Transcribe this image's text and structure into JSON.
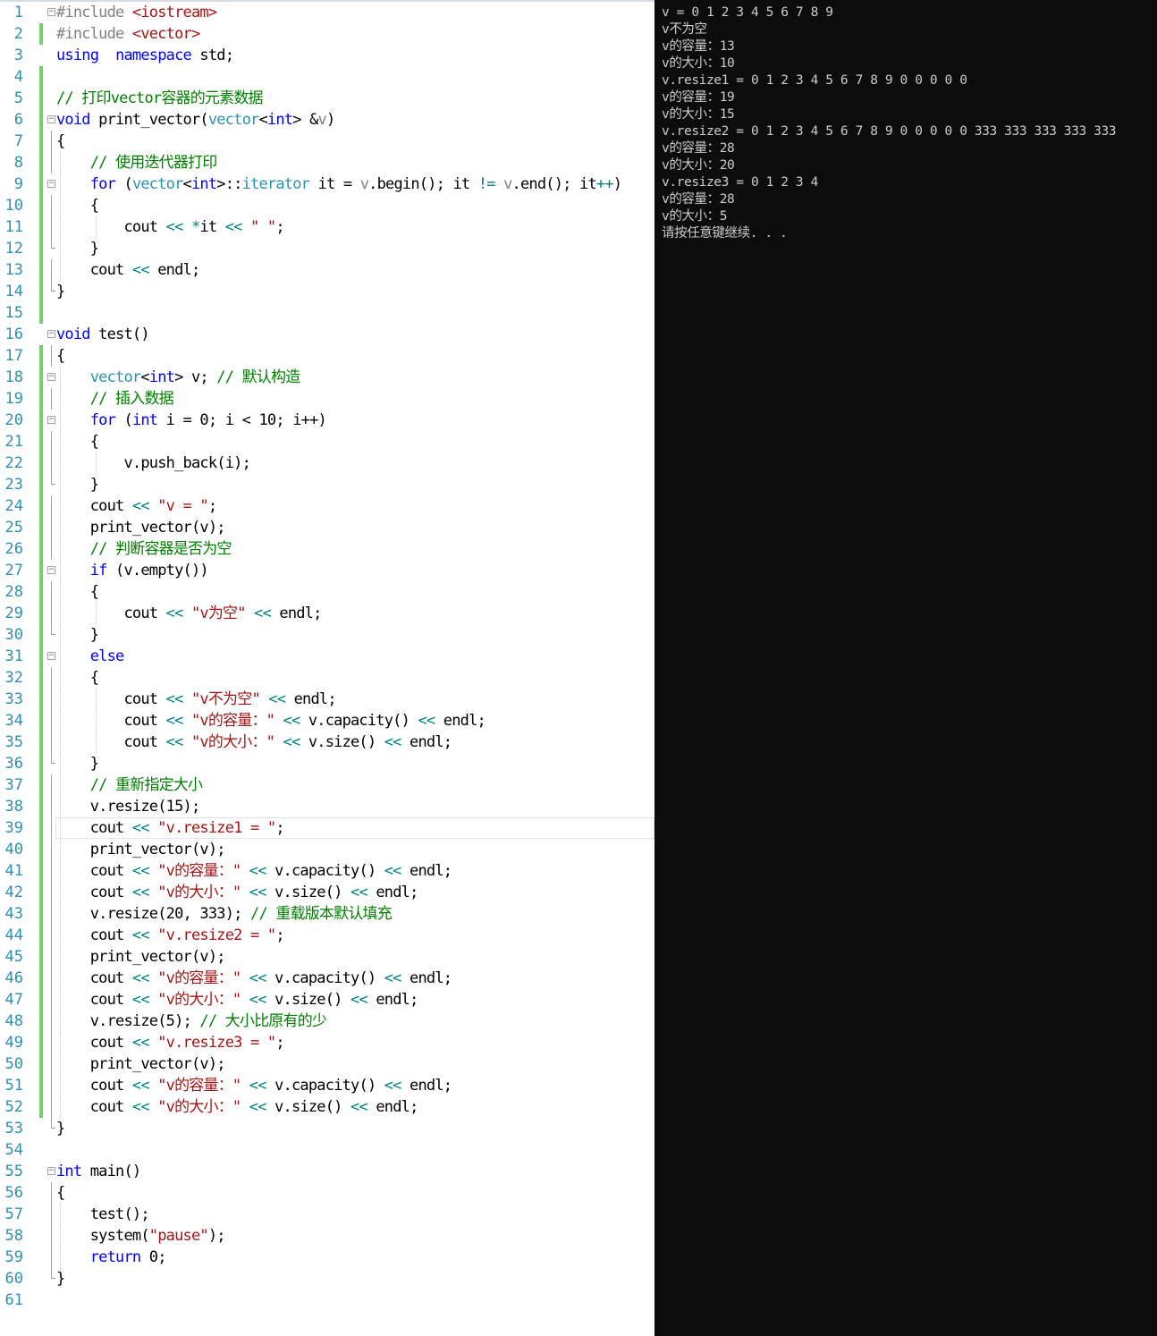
{
  "editor": {
    "lines": [
      {
        "n": "1",
        "fold": "open",
        "change": "none",
        "segs": [
          [
            "pp",
            "#include "
          ],
          [
            "str",
            "<iostream>"
          ]
        ]
      },
      {
        "n": "2",
        "change": "green",
        "segs": [
          [
            "pp",
            "#include "
          ],
          [
            "str",
            "<vector>"
          ]
        ]
      },
      {
        "n": "3",
        "change": "none",
        "segs": [
          [
            "kw",
            "using"
          ],
          [
            "",
            "  "
          ],
          [
            "kw",
            "namespace"
          ],
          [
            "",
            " std;"
          ]
        ]
      },
      {
        "n": "4",
        "change": "green",
        "segs": []
      },
      {
        "n": "5",
        "change": "green",
        "segs": [
          [
            "cm",
            "// 打印vector容器的元素数据"
          ]
        ]
      },
      {
        "n": "6",
        "fold": "open",
        "change": "green",
        "segs": [
          [
            "kw",
            "void"
          ],
          [
            "",
            " print_vector("
          ],
          [
            "ty",
            "vector"
          ],
          [
            "",
            "<"
          ],
          [
            "kw",
            "int"
          ],
          [
            "",
            "> &"
          ],
          [
            "pm",
            "v"
          ],
          [
            "",
            ")"
          ]
        ]
      },
      {
        "n": "7",
        "change": "green",
        "segs": [
          [
            "",
            "{"
          ]
        ]
      },
      {
        "n": "8",
        "change": "green",
        "segs": [
          [
            "",
            "    "
          ],
          [
            "cm",
            "// 使用迭代器打印"
          ]
        ]
      },
      {
        "n": "9",
        "fold": "open",
        "change": "green",
        "segs": [
          [
            "",
            "    "
          ],
          [
            "kw",
            "for"
          ],
          [
            "",
            " ("
          ],
          [
            "ty",
            "vector"
          ],
          [
            "",
            "<"
          ],
          [
            "kw",
            "int"
          ],
          [
            "",
            ">::"
          ],
          [
            "ty",
            "iterator"
          ],
          [
            "",
            " it = "
          ],
          [
            "pm",
            "v"
          ],
          [
            "",
            ".begin(); it "
          ],
          [
            "op",
            "!="
          ],
          [
            " ",
            " "
          ],
          [
            "pm",
            "v"
          ],
          [
            "",
            ".end(); it"
          ],
          [
            "op",
            "++"
          ],
          [
            "",
            ")"
          ]
        ]
      },
      {
        "n": "10",
        "change": "green",
        "segs": [
          [
            "",
            "    {"
          ]
        ]
      },
      {
        "n": "11",
        "change": "green",
        "segs": [
          [
            "",
            "        cout "
          ],
          [
            "op",
            "<<"
          ],
          [
            "",
            " "
          ],
          [
            "op",
            "*"
          ],
          [
            "",
            "it "
          ],
          [
            "op",
            "<<"
          ],
          [
            "",
            " "
          ],
          [
            "str",
            "\" \""
          ],
          [
            "",
            ";"
          ]
        ]
      },
      {
        "n": "12",
        "change": "green",
        "segs": [
          [
            "",
            "    }"
          ]
        ]
      },
      {
        "n": "13",
        "change": "green",
        "segs": [
          [
            "",
            "    cout "
          ],
          [
            "op",
            "<<"
          ],
          [
            "",
            " endl;"
          ]
        ]
      },
      {
        "n": "14",
        "change": "green",
        "segs": [
          [
            "",
            "}"
          ]
        ]
      },
      {
        "n": "15",
        "change": "green",
        "segs": []
      },
      {
        "n": "16",
        "fold": "open",
        "change": "none",
        "segs": [
          [
            "kw",
            "void"
          ],
          [
            "",
            " test()"
          ]
        ]
      },
      {
        "n": "17",
        "change": "green",
        "segs": [
          [
            "",
            "{"
          ]
        ]
      },
      {
        "n": "18",
        "fold": "open",
        "change": "green",
        "segs": [
          [
            "",
            "    "
          ],
          [
            "ty",
            "vector"
          ],
          [
            "",
            "<"
          ],
          [
            "kw",
            "int"
          ],
          [
            "",
            "> v; "
          ],
          [
            "cm",
            "// 默认构造"
          ]
        ]
      },
      {
        "n": "19",
        "change": "green",
        "segs": [
          [
            "",
            "    "
          ],
          [
            "cm",
            "// 插入数据"
          ]
        ]
      },
      {
        "n": "20",
        "fold": "open",
        "change": "green",
        "segs": [
          [
            "",
            "    "
          ],
          [
            "kw",
            "for"
          ],
          [
            "",
            " ("
          ],
          [
            "kw",
            "int"
          ],
          [
            "",
            " i = 0; i < 10; i++)"
          ]
        ]
      },
      {
        "n": "21",
        "change": "green",
        "segs": [
          [
            "",
            "    {"
          ]
        ]
      },
      {
        "n": "22",
        "change": "green",
        "segs": [
          [
            "",
            "        v.push_back(i);"
          ]
        ]
      },
      {
        "n": "23",
        "change": "green",
        "segs": [
          [
            "",
            "    }"
          ]
        ]
      },
      {
        "n": "24",
        "change": "green",
        "segs": [
          [
            "",
            "    cout "
          ],
          [
            "op",
            "<<"
          ],
          [
            "",
            " "
          ],
          [
            "str",
            "\"v = \""
          ],
          [
            "",
            ";"
          ]
        ]
      },
      {
        "n": "25",
        "change": "green",
        "segs": [
          [
            "",
            "    print_vector(v);"
          ]
        ]
      },
      {
        "n": "26",
        "change": "green",
        "segs": [
          [
            "",
            "    "
          ],
          [
            "cm",
            "// 判断容器是否为空"
          ]
        ]
      },
      {
        "n": "27",
        "fold": "open",
        "change": "green",
        "segs": [
          [
            "",
            "    "
          ],
          [
            "kw",
            "if"
          ],
          [
            "",
            " (v.empty())"
          ]
        ]
      },
      {
        "n": "28",
        "change": "green",
        "segs": [
          [
            "",
            "    {"
          ]
        ]
      },
      {
        "n": "29",
        "change": "green",
        "segs": [
          [
            "",
            "        cout "
          ],
          [
            "op",
            "<<"
          ],
          [
            "",
            " "
          ],
          [
            "str",
            "\"v为空\""
          ],
          [
            "",
            " "
          ],
          [
            "op",
            "<<"
          ],
          [
            "",
            " endl;"
          ]
        ]
      },
      {
        "n": "30",
        "change": "green",
        "segs": [
          [
            "",
            "    }"
          ]
        ]
      },
      {
        "n": "31",
        "fold": "open",
        "change": "green",
        "segs": [
          [
            "",
            "    "
          ],
          [
            "kw",
            "else"
          ]
        ]
      },
      {
        "n": "32",
        "change": "green",
        "segs": [
          [
            "",
            "    {"
          ]
        ]
      },
      {
        "n": "33",
        "change": "green",
        "segs": [
          [
            "",
            "        cout "
          ],
          [
            "op",
            "<<"
          ],
          [
            "",
            " "
          ],
          [
            "str",
            "\"v不为空\""
          ],
          [
            "",
            " "
          ],
          [
            "op",
            "<<"
          ],
          [
            "",
            " endl;"
          ]
        ]
      },
      {
        "n": "34",
        "change": "green",
        "segs": [
          [
            "",
            "        cout "
          ],
          [
            "op",
            "<<"
          ],
          [
            "",
            " "
          ],
          [
            "str",
            "\"v的容量：\""
          ],
          [
            "",
            " "
          ],
          [
            "op",
            "<<"
          ],
          [
            "",
            " v.capacity() "
          ],
          [
            "op",
            "<<"
          ],
          [
            "",
            " endl;"
          ]
        ]
      },
      {
        "n": "35",
        "change": "green",
        "segs": [
          [
            "",
            "        cout "
          ],
          [
            "op",
            "<<"
          ],
          [
            "",
            " "
          ],
          [
            "str",
            "\"v的大小：\""
          ],
          [
            "",
            " "
          ],
          [
            "op",
            "<<"
          ],
          [
            "",
            " v.size() "
          ],
          [
            "op",
            "<<"
          ],
          [
            "",
            " endl;"
          ]
        ]
      },
      {
        "n": "36",
        "change": "green",
        "segs": [
          [
            "",
            "    }"
          ]
        ]
      },
      {
        "n": "37",
        "change": "green",
        "segs": [
          [
            "",
            "    "
          ],
          [
            "cm",
            "// 重新指定大小"
          ]
        ]
      },
      {
        "n": "38",
        "change": "green",
        "segs": [
          [
            "",
            "    v.resize(15);"
          ]
        ]
      },
      {
        "n": "39",
        "change": "green",
        "current": true,
        "segs": [
          [
            "",
            "    cout "
          ],
          [
            "op",
            "<<"
          ],
          [
            "",
            " "
          ],
          [
            "str",
            "\"v.resize1 = \""
          ],
          [
            "",
            ";"
          ]
        ]
      },
      {
        "n": "40",
        "change": "green",
        "segs": [
          [
            "",
            "    print_vector(v);"
          ]
        ]
      },
      {
        "n": "41",
        "change": "green",
        "segs": [
          [
            "",
            "    cout "
          ],
          [
            "op",
            "<<"
          ],
          [
            "",
            " "
          ],
          [
            "str",
            "\"v的容量：\""
          ],
          [
            "",
            " "
          ],
          [
            "op",
            "<<"
          ],
          [
            "",
            " v.capacity() "
          ],
          [
            "op",
            "<<"
          ],
          [
            "",
            " endl;"
          ]
        ]
      },
      {
        "n": "42",
        "change": "green",
        "segs": [
          [
            "",
            "    cout "
          ],
          [
            "op",
            "<<"
          ],
          [
            "",
            " "
          ],
          [
            "str",
            "\"v的大小：\""
          ],
          [
            "",
            " "
          ],
          [
            "op",
            "<<"
          ],
          [
            "",
            " v.size() "
          ],
          [
            "op",
            "<<"
          ],
          [
            "",
            " endl;"
          ]
        ]
      },
      {
        "n": "43",
        "change": "green",
        "segs": [
          [
            "",
            "    v.resize(20, 333); "
          ],
          [
            "cm",
            "// 重载版本默认填充"
          ]
        ]
      },
      {
        "n": "44",
        "change": "green",
        "segs": [
          [
            "",
            "    cout "
          ],
          [
            "op",
            "<<"
          ],
          [
            "",
            " "
          ],
          [
            "str",
            "\"v.resize2 = \""
          ],
          [
            "",
            ";"
          ]
        ]
      },
      {
        "n": "45",
        "change": "green",
        "segs": [
          [
            "",
            "    print_vector(v);"
          ]
        ]
      },
      {
        "n": "46",
        "change": "green",
        "segs": [
          [
            "",
            "    cout "
          ],
          [
            "op",
            "<<"
          ],
          [
            "",
            " "
          ],
          [
            "str",
            "\"v的容量：\""
          ],
          [
            "",
            " "
          ],
          [
            "op",
            "<<"
          ],
          [
            "",
            " v.capacity() "
          ],
          [
            "op",
            "<<"
          ],
          [
            "",
            " endl;"
          ]
        ]
      },
      {
        "n": "47",
        "change": "green",
        "segs": [
          [
            "",
            "    cout "
          ],
          [
            "op",
            "<<"
          ],
          [
            "",
            " "
          ],
          [
            "str",
            "\"v的大小：\""
          ],
          [
            "",
            " "
          ],
          [
            "op",
            "<<"
          ],
          [
            "",
            " v.size() "
          ],
          [
            "op",
            "<<"
          ],
          [
            "",
            " endl;"
          ]
        ]
      },
      {
        "n": "48",
        "change": "green",
        "segs": [
          [
            "",
            "    v.resize(5); "
          ],
          [
            "cm",
            "// 大小比原有的少"
          ]
        ]
      },
      {
        "n": "49",
        "change": "green",
        "segs": [
          [
            "",
            "    cout "
          ],
          [
            "op",
            "<<"
          ],
          [
            "",
            " "
          ],
          [
            "str",
            "\"v.resize3 = \""
          ],
          [
            "",
            ";"
          ]
        ]
      },
      {
        "n": "50",
        "change": "green",
        "segs": [
          [
            "",
            "    print_vector(v);"
          ]
        ]
      },
      {
        "n": "51",
        "change": "green",
        "segs": [
          [
            "",
            "    cout "
          ],
          [
            "op",
            "<<"
          ],
          [
            "",
            " "
          ],
          [
            "str",
            "\"v的容量：\""
          ],
          [
            "",
            " "
          ],
          [
            "op",
            "<<"
          ],
          [
            "",
            " v.capacity() "
          ],
          [
            "op",
            "<<"
          ],
          [
            "",
            " endl;"
          ]
        ]
      },
      {
        "n": "52",
        "change": "green",
        "segs": [
          [
            "",
            "    cout "
          ],
          [
            "op",
            "<<"
          ],
          [
            "",
            " "
          ],
          [
            "str",
            "\"v的大小：\""
          ],
          [
            "",
            " "
          ],
          [
            "op",
            "<<"
          ],
          [
            "",
            " v.size() "
          ],
          [
            "op",
            "<<"
          ],
          [
            "",
            " endl;"
          ]
        ]
      },
      {
        "n": "53",
        "change": "none",
        "segs": [
          [
            "",
            "}"
          ]
        ]
      },
      {
        "n": "54",
        "change": "none",
        "segs": []
      },
      {
        "n": "55",
        "fold": "open",
        "change": "none",
        "segs": [
          [
            "kw",
            "int"
          ],
          [
            "",
            " main()"
          ]
        ]
      },
      {
        "n": "56",
        "change": "none",
        "segs": [
          [
            "",
            "{"
          ]
        ]
      },
      {
        "n": "57",
        "change": "none",
        "segs": [
          [
            "",
            "    test();"
          ]
        ]
      },
      {
        "n": "58",
        "change": "none",
        "segs": [
          [
            "",
            "    system("
          ],
          [
            "str",
            "\"pause\""
          ],
          [
            "",
            ");"
          ]
        ]
      },
      {
        "n": "59",
        "change": "none",
        "segs": [
          [
            "",
            "    "
          ],
          [
            "kw",
            "return"
          ],
          [
            "",
            " 0;"
          ]
        ]
      },
      {
        "n": "60",
        "change": "none",
        "segs": [
          [
            "",
            "}"
          ]
        ]
      },
      {
        "n": "61",
        "change": "none",
        "segs": []
      }
    ]
  },
  "console": {
    "lines": [
      "v = 0 1 2 3 4 5 6 7 8 9",
      "v不为空",
      "v的容量：13",
      "v的大小：10",
      "v.resize1 = 0 1 2 3 4 5 6 7 8 9 0 0 0 0 0",
      "v的容量：19",
      "v的大小：15",
      "v.resize2 = 0 1 2 3 4 5 6 7 8 9 0 0 0 0 0 333 333 333 333 333",
      "v的容量：28",
      "v的大小：20",
      "v.resize3 = 0 1 2 3 4",
      "v的容量：28",
      "v的大小：5",
      "请按任意键继续. . ."
    ]
  },
  "colors": {
    "keyword": "#0000ff",
    "type": "#2b91af",
    "preprocessor": "#808080",
    "string": "#a31515",
    "comment": "#008000",
    "change_bar": "#6fd26f",
    "console_bg": "#0c0c0c",
    "console_text": "#cccccc"
  }
}
